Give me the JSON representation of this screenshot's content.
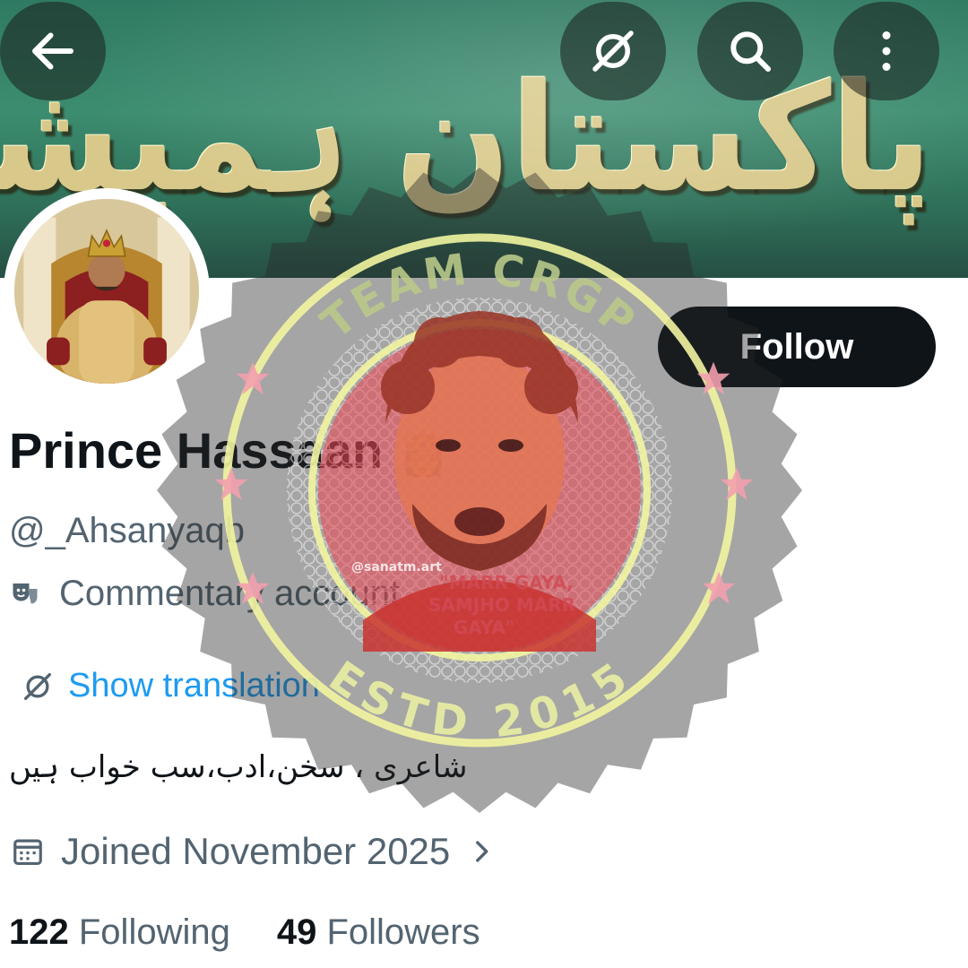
{
  "banner": {
    "text": "پاکستان ہمیشہ زندہ باد"
  },
  "toolbar": {
    "back_icon": "arrow-left-icon",
    "translate_icon": "translate-icon",
    "search_icon": "search-icon",
    "more_icon": "more-vertical-icon"
  },
  "profile": {
    "name": "Prince Hassaan",
    "name_emoji": "👸",
    "handle": "@_Ahsanyaqb",
    "label": "Commentary account",
    "show_translation": "Show translation",
    "bio": "شاعری ، سخن،ادب،سب خواب ہیں",
    "joined": "Joined November 2025",
    "following_count": "122",
    "following_label": "Following",
    "followers_count": "49",
    "followers_label": "Followers",
    "follow_button": "Follow"
  },
  "watermark": {
    "top_text": "TEAM CRGP",
    "bottom_text": "ESTD 2015",
    "credit": "@sanatm.art",
    "quote_line1": "\"MARR GAYA,",
    "quote_line2": "SAMJHO MARR",
    "quote_line3": "GAYA\""
  },
  "colors": {
    "accent_blue": "#1d9bf0",
    "text_primary": "#0f1419",
    "text_secondary": "#536471",
    "banner_green": "#3c8d70",
    "watermark_yellow": "#f2f5a0",
    "watermark_pink": "#f3a0ae"
  }
}
